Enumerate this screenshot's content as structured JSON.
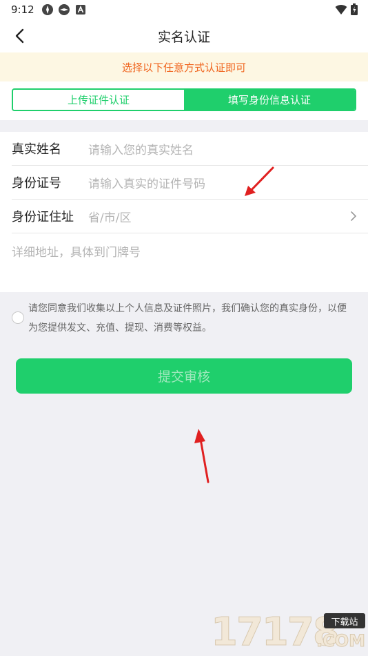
{
  "status_bar": {
    "time": "9:12"
  },
  "nav": {
    "title": "实名认证"
  },
  "notice": "选择以下任意方式认证即可",
  "tabs": [
    {
      "label": "上传证件认证",
      "active": false
    },
    {
      "label": "填写身份信息认证",
      "active": true
    }
  ],
  "form": {
    "name": {
      "label": "真实姓名",
      "placeholder": "请输入您的真实姓名"
    },
    "id_number": {
      "label": "身份证号",
      "placeholder": "请输入真实的证件号码"
    },
    "address": {
      "label": "身份证住址",
      "placeholder": "省/市/区"
    },
    "detail_placeholder": "详细地址，具体到门牌号"
  },
  "agreement": {
    "text": "请您同意我们收集以上个人信息及证件照片，我们确认您的真实身份，以便为您提供发文、充值、提现、消费等权益。"
  },
  "submit_label": "提交审核",
  "watermark": {
    "number": "17178",
    "badge": "下载站",
    "suffix": ".COM"
  },
  "colors": {
    "accent": "#1fcf6c",
    "notice_text": "#f0651f",
    "notice_bg": "#fdf7e3",
    "arrow": "#e02020"
  }
}
